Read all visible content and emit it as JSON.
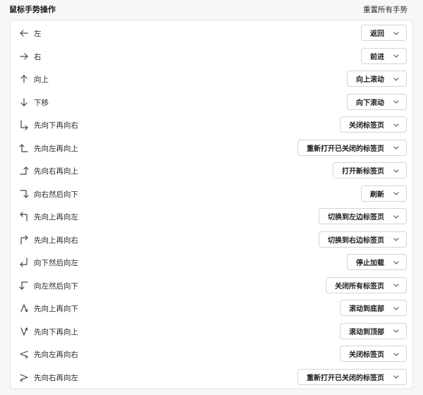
{
  "header": {
    "title": "鼠标手势操作",
    "reset_label": "重置所有手势"
  },
  "gestures": [
    {
      "icon": "arrow-left-icon",
      "label": "左",
      "action": "返回"
    },
    {
      "icon": "arrow-right-icon",
      "label": "右",
      "action": "前进"
    },
    {
      "icon": "arrow-up-icon",
      "label": "向上",
      "action": "向上滚动"
    },
    {
      "icon": "arrow-down-icon",
      "label": "下移",
      "action": "向下滚动"
    },
    {
      "icon": "down-then-right-icon",
      "label": "先向下再向右",
      "action": "关闭标签页"
    },
    {
      "icon": "left-then-up-icon",
      "label": "先向左再向上",
      "action": "重新打开已关闭的标签页"
    },
    {
      "icon": "right-then-up-icon",
      "label": "先向右再向上",
      "action": "打开新标签页"
    },
    {
      "icon": "right-then-down-icon",
      "label": "向右然后向下",
      "action": "刷新"
    },
    {
      "icon": "up-then-left-icon",
      "label": "先向上再向左",
      "action": "切换到左边标签页"
    },
    {
      "icon": "up-then-right-icon",
      "label": "先向上再向右",
      "action": "切换到右边标签页"
    },
    {
      "icon": "down-then-left-icon",
      "label": "向下然后向左",
      "action": "停止加载"
    },
    {
      "icon": "left-then-down-icon",
      "label": "向左然后向下",
      "action": "关闭所有标签页"
    },
    {
      "icon": "up-then-down-icon",
      "label": "先向上再向下",
      "action": "滚动到底部"
    },
    {
      "icon": "down-then-up-icon",
      "label": "先向下再向上",
      "action": "滚动到顶部"
    },
    {
      "icon": "left-then-right-icon",
      "label": "先向左再向右",
      "action": "关闭标签页"
    },
    {
      "icon": "right-then-left-icon",
      "label": "先向右再向左",
      "action": "重新打开已关闭的标签页"
    }
  ]
}
